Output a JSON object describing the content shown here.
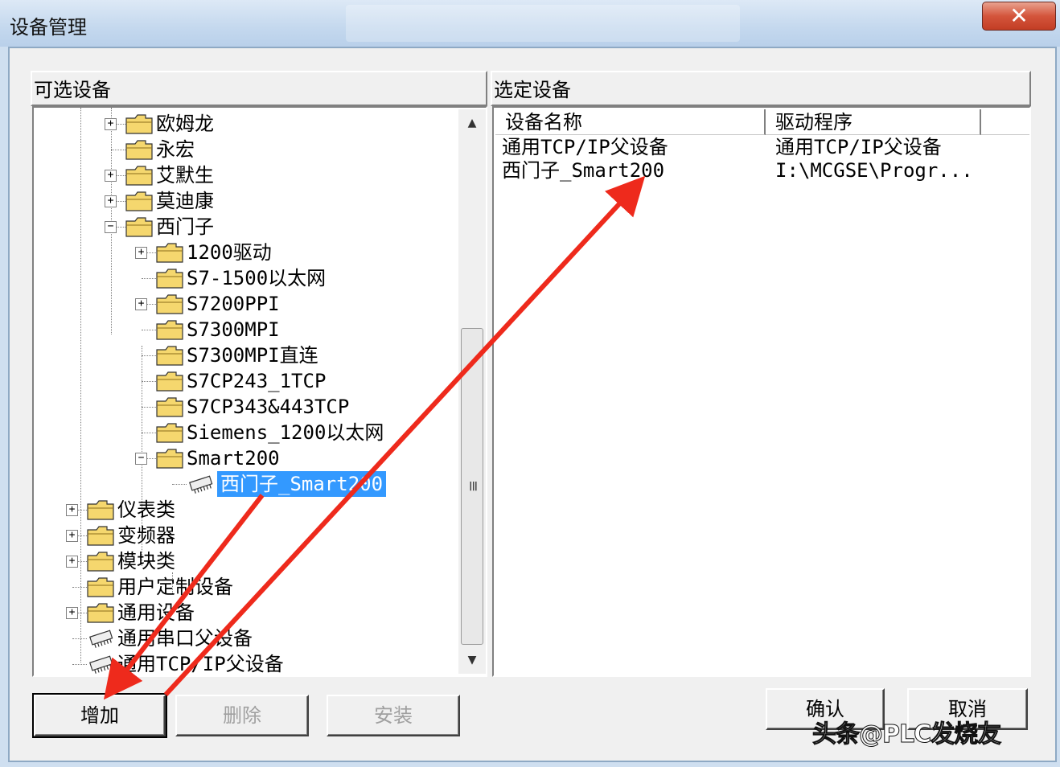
{
  "window": {
    "title": "设备管理",
    "close_label": "✕"
  },
  "left_panel": {
    "header": "可选设备",
    "tree": [
      {
        "label": "欧姆龙",
        "indent": 1,
        "expander": "+",
        "icon": "folder-icon"
      },
      {
        "label": "永宏",
        "indent": 1,
        "expander": "",
        "icon": "folder-icon"
      },
      {
        "label": "艾默生",
        "indent": 1,
        "expander": "+",
        "icon": "folder-icon"
      },
      {
        "label": "莫迪康",
        "indent": 1,
        "expander": "+",
        "icon": "folder-icon"
      },
      {
        "label": "西门子",
        "indent": 1,
        "expander": "−",
        "icon": "folder-icon"
      },
      {
        "label": "1200驱动",
        "indent": 2,
        "expander": "+",
        "icon": "folder-icon"
      },
      {
        "label": "S7-1500以太网",
        "indent": 2,
        "expander": "",
        "icon": "folder-icon"
      },
      {
        "label": "S7200PPI",
        "indent": 2,
        "expander": "+",
        "icon": "folder-icon"
      },
      {
        "label": "S7300MPI",
        "indent": 2,
        "expander": "",
        "icon": "folder-icon"
      },
      {
        "label": "S7300MPI直连",
        "indent": 2,
        "expander": "",
        "icon": "folder-icon"
      },
      {
        "label": "S7CP243_1TCP",
        "indent": 2,
        "expander": "",
        "icon": "folder-icon"
      },
      {
        "label": "S7CP343&443TCP",
        "indent": 2,
        "expander": "",
        "icon": "folder-icon"
      },
      {
        "label": "Siemens_1200以太网",
        "indent": 2,
        "expander": "",
        "icon": "folder-icon"
      },
      {
        "label": "Smart200",
        "indent": 2,
        "expander": "−",
        "icon": "folder-icon"
      },
      {
        "label": "西门子_Smart200",
        "indent": 3,
        "expander": "",
        "icon": "device-chip-icon",
        "selected": true
      },
      {
        "label": "仪表类",
        "indent": 0,
        "expander": "+",
        "icon": "folder-icon"
      },
      {
        "label": "变频器",
        "indent": 0,
        "expander": "+",
        "icon": "folder-icon"
      },
      {
        "label": "模块类",
        "indent": 0,
        "expander": "+",
        "icon": "folder-icon"
      },
      {
        "label": "用户定制设备",
        "indent": 0,
        "expander": "",
        "icon": "folder-icon"
      },
      {
        "label": "通用设备",
        "indent": 0,
        "expander": "+",
        "icon": "folder-icon"
      },
      {
        "label": "通用串口父设备",
        "indent": 0,
        "expander": "",
        "icon": "device-chip-icon"
      },
      {
        "label": "通用TCP/IP父设备",
        "indent": 0,
        "expander": "",
        "icon": "device-chip-icon"
      }
    ]
  },
  "right_panel": {
    "header": "选定设备",
    "columns": [
      "设备名称",
      "驱动程序"
    ],
    "rows": [
      {
        "name": "通用TCP/IP父设备",
        "driver": "通用TCP/IP父设备"
      },
      {
        "name": "西门子_Smart200",
        "driver": "I:\\MCGSE\\Progr..."
      }
    ]
  },
  "buttons": {
    "add": "增加",
    "delete": "删除",
    "install": "安装",
    "ok": "确认",
    "cancel": "取消"
  },
  "watermark": "头条@PLC发烧友",
  "colors": {
    "selection": "#3399ff",
    "annotation_arrow": "#ee2a1c",
    "folder": "#f5d76e"
  }
}
